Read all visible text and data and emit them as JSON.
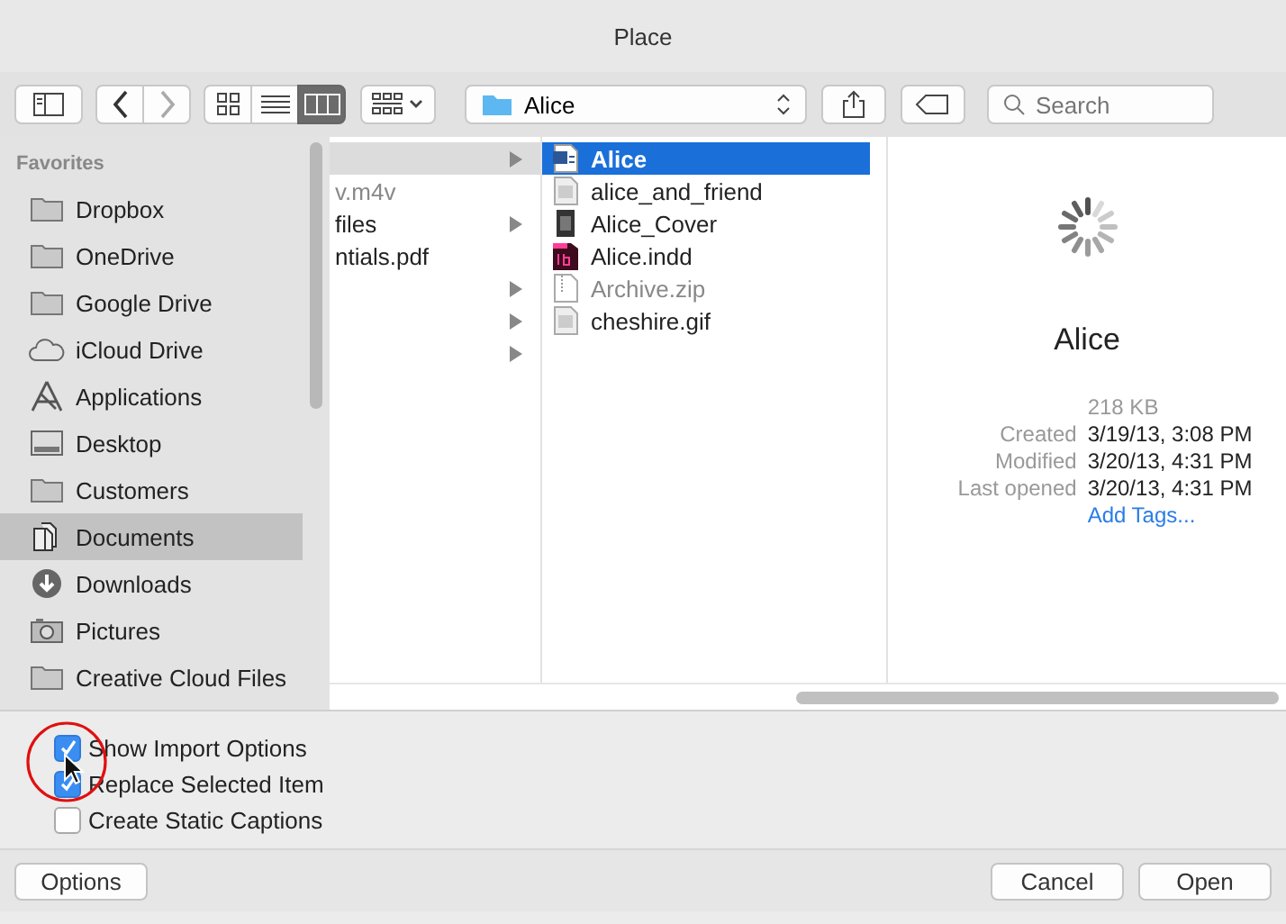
{
  "window": {
    "title": "Place"
  },
  "toolbar": {
    "views": [
      {
        "kind": "icons",
        "selected": false
      },
      {
        "kind": "list",
        "selected": false
      },
      {
        "kind": "columns",
        "selected": true
      }
    ],
    "location": "Alice",
    "search": {
      "placeholder": "Search"
    }
  },
  "sidebar": {
    "heading": "Favorites",
    "items": [
      {
        "label": "Dropbox",
        "kind": "folder",
        "selected": false
      },
      {
        "label": "OneDrive",
        "kind": "folder",
        "selected": false
      },
      {
        "label": "Google Drive",
        "kind": "folder",
        "selected": false
      },
      {
        "label": "iCloud Drive",
        "kind": "cloud",
        "selected": false
      },
      {
        "label": "Applications",
        "kind": "apps",
        "selected": false
      },
      {
        "label": "Desktop",
        "kind": "desktop",
        "selected": false
      },
      {
        "label": "Customers",
        "kind": "folder",
        "selected": false
      },
      {
        "label": "Documents",
        "kind": "documents",
        "selected": true
      },
      {
        "label": "Downloads",
        "kind": "downloads",
        "selected": false
      },
      {
        "label": "Pictures",
        "kind": "camera",
        "selected": false
      },
      {
        "label": "Creative Cloud Files",
        "kind": "folder",
        "selected": false
      }
    ]
  },
  "column_1": [
    {
      "selected": true,
      "kind": "folder"
    },
    {
      "name": "v.m4v",
      "selected": false,
      "kind": "file",
      "dim": true
    },
    {
      "name": "files",
      "selected": false,
      "kind": "folder",
      "dim": false
    },
    {
      "name": "ntials.pdf",
      "selected": false,
      "kind": "file",
      "dim": false
    },
    {
      "selected": false,
      "kind": "folder"
    },
    {
      "selected": false,
      "kind": "folder"
    },
    {
      "selected": false,
      "kind": "folder"
    }
  ],
  "column_2": [
    {
      "name": "Alice",
      "kind": "word",
      "selected": true,
      "dim": false
    },
    {
      "name": "alice_and_friend",
      "kind": "image",
      "selected": false,
      "dim": false
    },
    {
      "name": "Alice_Cover",
      "kind": "photo",
      "selected": false,
      "dim": false
    },
    {
      "name": "Alice.indd",
      "kind": "indesign",
      "selected": false,
      "dim": false
    },
    {
      "name": "Archive.zip",
      "kind": "zip",
      "selected": false,
      "dim": true
    },
    {
      "name": "cheshire.gif",
      "kind": "image",
      "selected": false,
      "dim": false
    }
  ],
  "preview": {
    "name": "Alice",
    "size": "218 KB",
    "fields": [
      {
        "label": "Created",
        "value": "3/19/13, 3:08 PM"
      },
      {
        "label": "Modified",
        "value": "3/20/13, 4:31 PM"
      },
      {
        "label": "Last opened",
        "value": "3/20/13, 4:31 PM"
      }
    ],
    "link": "Add Tags..."
  },
  "options": [
    {
      "label": "Show Import Options",
      "checked": true
    },
    {
      "label": "Replace Selected Item",
      "checked": true
    },
    {
      "label": "Create Static Captions",
      "checked": false
    }
  ],
  "buttons": {
    "left": "Options",
    "cancel": "Cancel",
    "open": "Open"
  }
}
